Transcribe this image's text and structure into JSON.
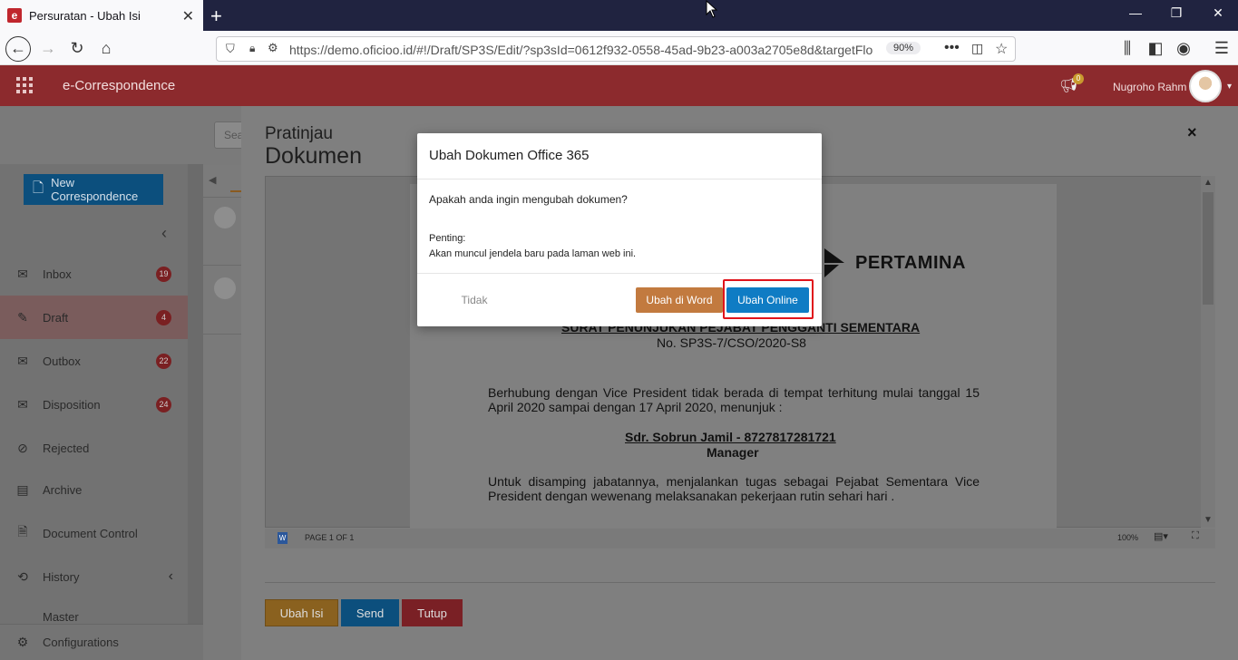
{
  "browser": {
    "tab_title": "Persuratan - Ubah Isi",
    "favicon_letter": "e",
    "url": "https://demo.oficioo.id/#!/Draft/SP3S/Edit/?sp3sId=0612f932-0558-45ad-9b23-a003a2705e8d&targetFlo",
    "zoom": "90%"
  },
  "app": {
    "title": "e-Correspondence",
    "notification_count": "0",
    "user_name": "Nugroho Rahm"
  },
  "sidebar": {
    "new_button": "New Correspondence",
    "items": [
      {
        "label": "Inbox",
        "badge": "19"
      },
      {
        "label": "Draft",
        "badge": "4"
      },
      {
        "label": "Outbox",
        "badge": "22"
      },
      {
        "label": "Disposition",
        "badge": "24"
      },
      {
        "label": "Rejected",
        "badge": ""
      },
      {
        "label": "Archive",
        "badge": ""
      },
      {
        "label": "Document Control",
        "badge": ""
      },
      {
        "label": "History",
        "badge": ""
      },
      {
        "label": "Master",
        "badge": ""
      }
    ],
    "configurations": "Configurations"
  },
  "search_stub": "Sea",
  "preview": {
    "title_line1": "Pratinjau",
    "title_line2": "Dokumen",
    "close": "×",
    "document": {
      "logo_text": "PERTAMINA",
      "heading": "SURAT PENUNJUKAN PEJABAT PENGGANTI SEMENTARA",
      "number": "No. SP3S-7/CSO/2020-S8",
      "para1": "Berhubung dengan Vice President tidak berada di tempat terhitung mulai tanggal 15 April 2020 sampai dengan 17 April 2020, menunjuk :",
      "person": "Sdr. Sobrun Jamil - 8727817281721",
      "position": "Manager",
      "para2": "Untuk disamping jabatannya, menjalankan tugas sebagai Pejabat Sementara Vice President dengan wewenang melaksanakan pekerjaan rutin sehari hari ."
    },
    "status": {
      "page": "PAGE 1 OF 1",
      "zoom": "100%"
    },
    "buttons": {
      "edit": "Ubah Isi",
      "send": "Send",
      "close": "Tutup"
    }
  },
  "modal": {
    "title": "Ubah Dokumen Office 365",
    "question": "Apakah anda ingin mengubah dokumen?",
    "important_label": "Penting:",
    "note": "Akan muncul jendela baru pada laman web ini.",
    "btn_no": "Tidak",
    "btn_word": "Ubah di Word",
    "btn_online": "Ubah Online"
  },
  "colors": {
    "header": "#8c2a2d",
    "primary": "#0f7cc4",
    "word": "#c27a3f",
    "highlight": "#e0141b"
  }
}
